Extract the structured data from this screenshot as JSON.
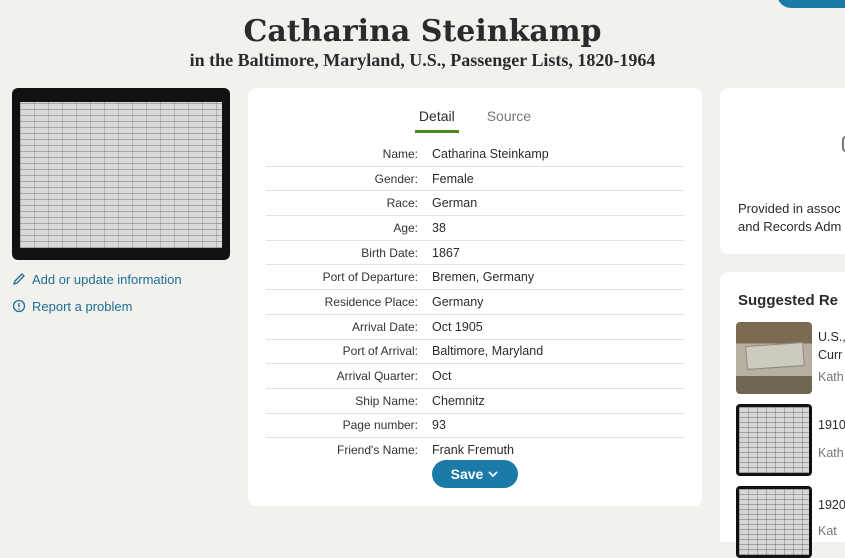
{
  "header": {
    "title": "Catharina Steinkamp",
    "subtitle": "in the Baltimore, Maryland, U.S., Passenger Lists, 1820-1964"
  },
  "sidebar": {
    "links": [
      {
        "label": "Add or update information",
        "icon": "pencil-icon"
      },
      {
        "label": "Report a problem",
        "icon": "alert-circle-icon"
      }
    ]
  },
  "tabs": [
    {
      "label": "Detail",
      "active": true
    },
    {
      "label": "Source",
      "active": false
    }
  ],
  "details": [
    {
      "label": "Name:",
      "value": "Catharina Steinkamp"
    },
    {
      "label": "Gender:",
      "value": "Female"
    },
    {
      "label": "Race:",
      "value": "German"
    },
    {
      "label": "Age:",
      "value": "38"
    },
    {
      "label": "Birth Date:",
      "value": "1867"
    },
    {
      "label": "Port of Departure:",
      "value": "Bremen, Germany"
    },
    {
      "label": "Residence Place:",
      "value": "Germany"
    },
    {
      "label": "Arrival Date:",
      "value": "Oct 1905"
    },
    {
      "label": "Port of Arrival:",
      "value": "Baltimore, Maryland"
    },
    {
      "label": "Arrival Quarter:",
      "value": "Oct"
    },
    {
      "label": "Ship Name:",
      "value": "Chemnitz"
    },
    {
      "label": "Page number:",
      "value": "93"
    },
    {
      "label": "Friend's Name:",
      "value": "Frank Fremuth"
    }
  ],
  "save": {
    "label": "Save"
  },
  "provided": {
    "line1": "Provided in assoc",
    "line2": "and Records Adm"
  },
  "suggested": {
    "title": "Suggested Re",
    "items": [
      {
        "line1": "U.S.,",
        "line2": "Curr",
        "sub": "Kath"
      },
      {
        "line1": "1910",
        "line2": "",
        "sub": "Kath"
      },
      {
        "line1": "1920",
        "line2": "",
        "sub": "Kat"
      }
    ]
  },
  "colors": {
    "accent": "#1b7aa8",
    "tab_underline": "#4d8b1f",
    "link": "#1b6f96"
  }
}
